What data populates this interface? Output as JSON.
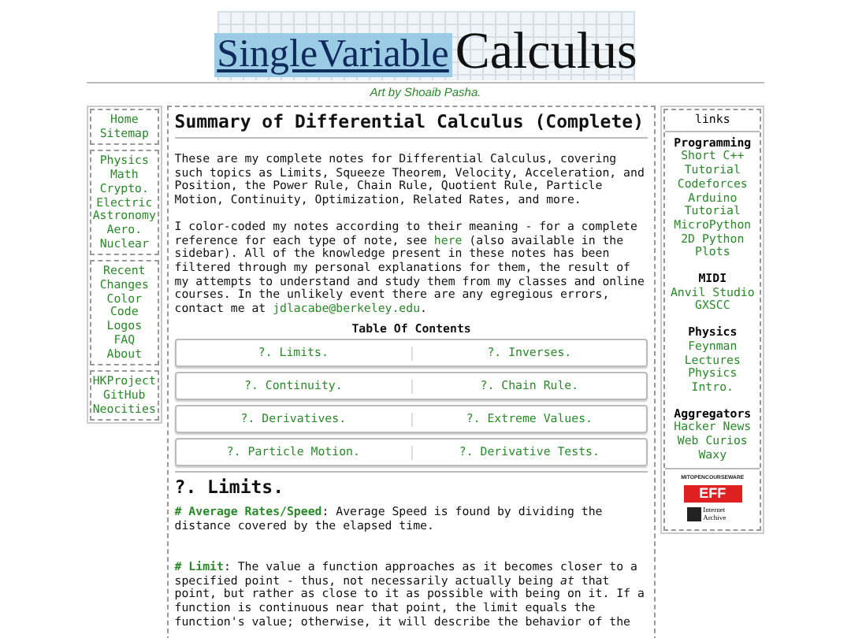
{
  "banner": {
    "title_part1": "SingleVariable",
    "title_part2": "Calculus"
  },
  "credit": "Art by Shoaib Pasha.",
  "left_sidebar": {
    "groups": [
      {
        "links": [
          "Home",
          "Sitemap"
        ]
      },
      {
        "links": [
          "Physics",
          "Math",
          "Crypto.",
          "Electric",
          "Astronomy",
          "Aero.",
          "Nuclear"
        ]
      },
      {
        "links": [
          "Recent",
          "Changes",
          "Color",
          "Code",
          "Logos",
          "FAQ",
          "About"
        ]
      },
      {
        "links": [
          "HKProject",
          "GitHub",
          "Neocities"
        ]
      }
    ]
  },
  "main": {
    "title": "Summary of Differential Calculus (Complete)",
    "paragraphs": [
      [
        {
          "kind": "text",
          "text": "These are my complete notes for Differential Calculus, covering such topics as Limits, Squeeze Theorem, Velocity, Acceleration, and Position, the Power Rule, Chain Rule, Quotient Rule, Particle Motion, Continuity, Optimization, Related Rates, and more."
        }
      ],
      [
        {
          "kind": "text",
          "text": "I color-coded my notes according to their meaning - for a complete reference for each type of note, see "
        },
        {
          "kind": "link",
          "text": "here"
        },
        {
          "kind": "text",
          "text": " (also available in the sidebar). All of the knowledge present in these notes has been filtered through my personal explanations for them, the result of my attempts to understand and study them from my classes and online courses. In the unlikely event there are any egregious errors, contact me at "
        },
        {
          "kind": "link",
          "text": "jdlacabe@berkeley.edu"
        },
        {
          "kind": "text",
          "text": "."
        }
      ]
    ],
    "toc": {
      "title": "Table Of Contents",
      "rows": [
        [
          "?. Limits.",
          "?. Inverses."
        ],
        [
          "?. Continuity.",
          "?. Chain Rule."
        ],
        [
          "?. Derivatives.",
          "?. Extreme Values."
        ],
        [
          "?. Particle Motion.",
          "?. Derivative Tests."
        ]
      ]
    },
    "section": {
      "title": "?. Limits.",
      "entries": [
        {
          "term": "# Average Rates/Speed",
          "text": ": Average Speed is found by dividing the distance covered by the elapsed time."
        },
        {
          "term": "# Limit",
          "text": ": The value a function approaches as it becomes closer to a specified point - thus, not necessarily actually being *at* that point, but rather as close to it as possible with being on it. If a function is continuous near that point, the limit equals the function's value; otherwise, it will describe the behavior of the"
        }
      ]
    }
  },
  "right_sidebar": {
    "title": "links",
    "sections": [
      {
        "heading": "Programming",
        "links": [
          "Short C++ Tutorial",
          "Codeforces",
          "Arduino Tutorial",
          "MicroPython",
          "2D Python Plots"
        ]
      },
      {
        "heading": "MIDI",
        "links": [
          "Anvil Studio",
          "GXSCC"
        ]
      },
      {
        "heading": "Physics",
        "links": [
          "Feynman Lectures",
          "Physics Intro."
        ]
      },
      {
        "heading": "Aggregators",
        "links": [
          "Hacker News",
          "Web Curios",
          "Waxy"
        ]
      }
    ],
    "badges": [
      {
        "kind": "mit",
        "text": "MITOPENCOURSEWARE"
      },
      {
        "kind": "eff",
        "text": "EFF"
      },
      {
        "kind": "archive",
        "text": "Internet Archive"
      }
    ]
  }
}
